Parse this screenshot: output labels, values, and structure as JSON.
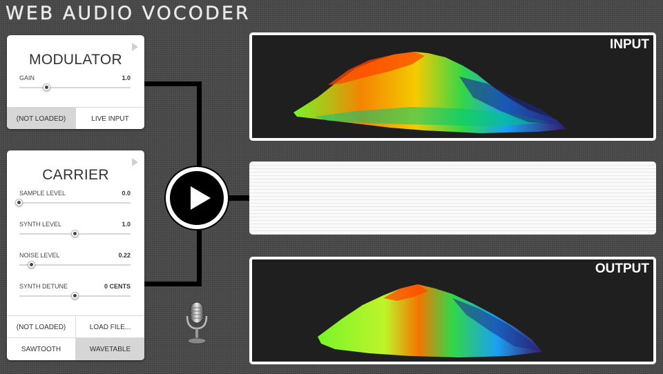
{
  "app": {
    "title": "WEB AUDIO VOCODER"
  },
  "modulator": {
    "title": "MODULATOR",
    "gain": {
      "label": "GAIN",
      "value": "1.0",
      "level": 0.25
    },
    "buttons": {
      "file": "(NOT LOADED)",
      "live": "LIVE INPUT"
    }
  },
  "carrier": {
    "title": "CARRIER",
    "sample_level": {
      "label": "SAMPLE LEVEL",
      "value": "0.0",
      "level": 0.0
    },
    "synth_level": {
      "label": "SYNTH LEVEL",
      "value": "1.0",
      "level": 0.5
    },
    "noise_level": {
      "label": "NOISE LEVEL",
      "value": "0.22",
      "level": 0.11
    },
    "synth_detune": {
      "label": "SYNTH DETUNE",
      "value": "0 CENTS",
      "level": 0.5
    },
    "buttons": {
      "file": "(NOT LOADED)",
      "load": "LOAD FILE...",
      "saw": "SAWTOOTH",
      "wave": "WAVETABLE"
    }
  },
  "input_viz": {
    "label": "INPUT"
  },
  "output_viz": {
    "label": "OUTPUT"
  },
  "icons": {
    "play": "play-icon",
    "mic": "microphone-icon",
    "collapse": "collapse-arrow-icon"
  },
  "colors": {
    "background": "#4a4a4a",
    "panel": "#ffffff",
    "active_button": "#d6d6d6",
    "viz_bg": "#1f1f1f"
  }
}
